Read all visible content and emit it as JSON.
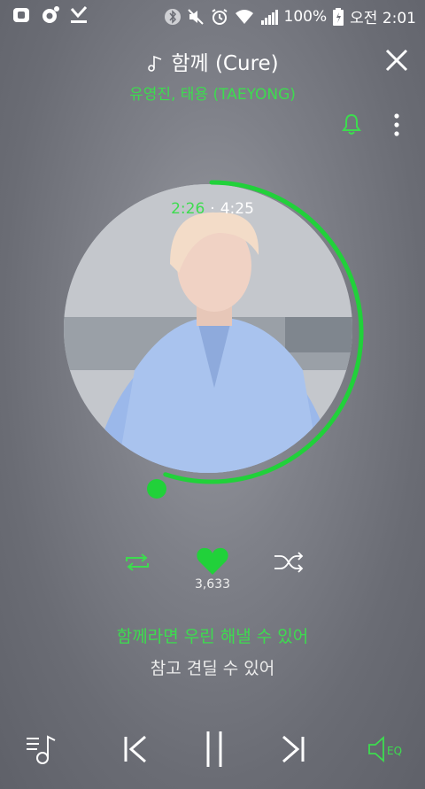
{
  "status_bar": {
    "battery": "100%",
    "time": "오전 2:01",
    "left_icons": [
      "app-icon",
      "circle-dot-icon",
      "download-icon"
    ],
    "right_icons": [
      "bluetooth-icon",
      "mute-icon",
      "alarm-icon",
      "wifi-icon",
      "signal-icon",
      "battery-icon"
    ]
  },
  "player": {
    "title": "함께 (Cure)",
    "artist": "유영진, 태용 (TAEYONG)",
    "current_time": "2:26",
    "separator": "·",
    "total_time": "4:25",
    "progress": 0.55,
    "like_count": "3,633",
    "lyric_current": "함께라면 우린 해낼 수 있어",
    "lyric_next": "참고 견딜 수 있어"
  },
  "colors": {
    "accent": "#3ddc4f",
    "progress": "#21d13a"
  },
  "icons": {
    "header": [
      "music-note-icon",
      "close-icon",
      "bell-icon",
      "more-vertical-icon"
    ],
    "controls": [
      "repeat-icon",
      "heart-icon",
      "shuffle-icon"
    ],
    "bottom": [
      "playlist-icon",
      "previous-icon",
      "pause-icon",
      "next-icon",
      "eq-icon"
    ]
  },
  "eq_label": "EQ"
}
